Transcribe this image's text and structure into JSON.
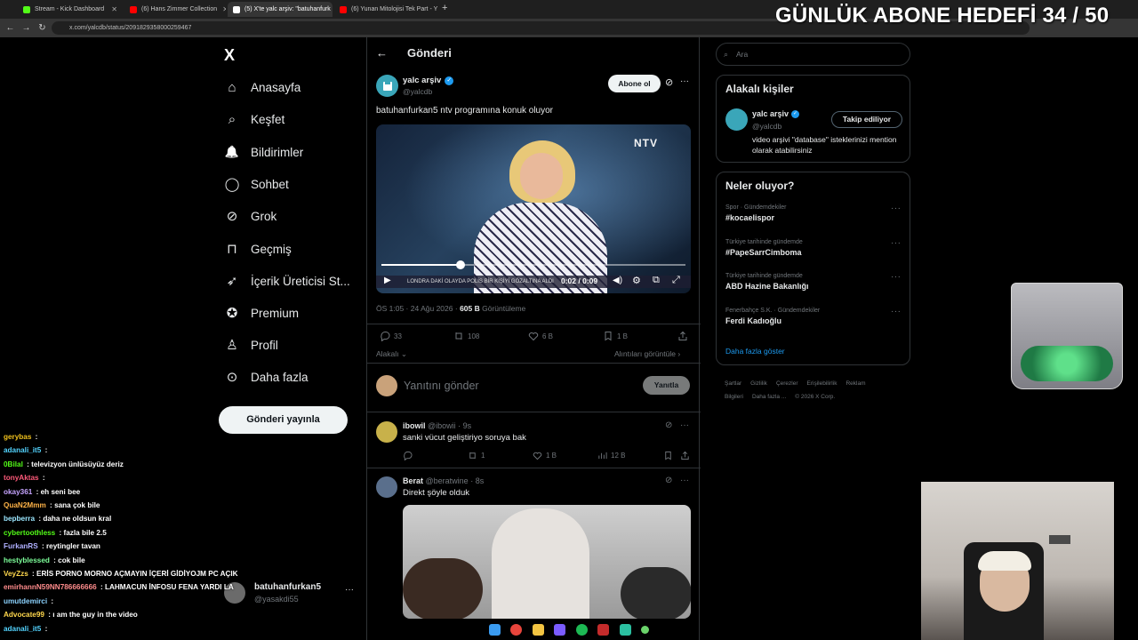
{
  "browser": {
    "tabs": [
      {
        "label": "Stream - Kick Dashboard",
        "fav_color": "#53fc18"
      },
      {
        "label": "(6) Hans Zimmer Collection",
        "fav_color": "#ff0000"
      },
      {
        "label": "(5) X'te yalc arşiv: \"batuhanfurk",
        "fav_color": "#ffffff"
      },
      {
        "label": "(6) Yunan Mitolojisi Tek Part - Y",
        "fav_color": "#ff0000"
      }
    ],
    "url": "x.com/yalcdb/status/2091829358000259467"
  },
  "overlay": {
    "goal_text": "GÜNLÜK ABONE HEDEFİ 34 / 50"
  },
  "nav": {
    "logo": "X",
    "items": [
      {
        "label": "Anasayfa",
        "icon": "home-icon"
      },
      {
        "label": "Keşfet",
        "icon": "search-icon"
      },
      {
        "label": "Bildirimler",
        "icon": "bell-icon"
      },
      {
        "label": "Sohbet",
        "icon": "chat-icon"
      },
      {
        "label": "Grok",
        "icon": "grok-icon"
      },
      {
        "label": "Geçmiş",
        "icon": "bookmark-icon"
      },
      {
        "label": "İçerik Üreticisi St...",
        "icon": "rocket-icon"
      },
      {
        "label": "Premium",
        "icon": "verified-icon"
      },
      {
        "label": "Profil",
        "icon": "person-icon"
      },
      {
        "label": "Daha fazla",
        "icon": "more-circle-icon"
      }
    ],
    "post_button": "Gönderi yayınla",
    "account": {
      "name": "batuhanfurkan5",
      "handle": "@yasakdi55"
    }
  },
  "post": {
    "header_title": "Gönderi",
    "author_name": "yalc arşiv",
    "author_handle": "@yalcdb",
    "subscribe_label": "Abone ol",
    "text": "batuhanfurkan5 ntv programına konuk oluyor",
    "video": {
      "time": "0:02 / 0:09",
      "progress": 0.26,
      "channel_logo": "NTV",
      "ticker": "LONDRA DAKİ OLAYDA POLİS BİR KİŞİYİ GÖZALTINA ALDI"
    },
    "timestamp": "ÖS 1:05 · 24 Ağu 2026 ·",
    "views_count": "605 B",
    "views_label": "Görüntüleme",
    "metrics": {
      "replies": "33",
      "reposts": "108",
      "likes": "6 B",
      "bookmarks": "1 B"
    },
    "relevant_label": "Alakalı",
    "quotes_link": "Alıntıları görüntüle",
    "reply_placeholder": "Yanıtını gönder",
    "reply_button": "Yanıtla"
  },
  "replies": [
    {
      "name": "ibowil",
      "handle": "@ibowii · 9s",
      "text": "sanki vücut geliştiriyo soruya bak",
      "replies": "",
      "reposts": "1",
      "likes": "1 B",
      "views": "12 B"
    },
    {
      "name": "Berat",
      "handle": "@beratwine · 8s",
      "text": "Direkt şöyle olduk"
    }
  ],
  "sidebar": {
    "search_placeholder": "Ara",
    "relevant_title": "Alakalı kişiler",
    "relevant_person": {
      "name": "yalc arşiv",
      "handle": "@yalcdb",
      "follow_label": "Takip ediliyor",
      "bio": "video arşivi \"database\" isteklerinizi mention olarak atabilirsiniz"
    },
    "trends_title": "Neler oluyor?",
    "trends": [
      {
        "meta": "Spor · Gündemdekiler",
        "name": "#kocaelispor"
      },
      {
        "meta": "Türkiye tarihinde gündemde",
        "name": "#PapeSarrCimboma"
      },
      {
        "meta": "Türkiye tarihinde gündemde",
        "name": "ABD Hazine Bakanlığı"
      },
      {
        "meta": "Fenerbahçe S.K. · Gündemdekiler",
        "name": "Ferdi Kadıoğlu"
      }
    ],
    "show_more": "Daha fazla göster",
    "footer": [
      "Şartlar",
      "Gizlilik",
      "Çerezler",
      "Erişilebilirlik",
      "Reklam Bilgileri",
      "Daha fazla ...",
      "© 2026 X Corp."
    ]
  },
  "chat": [
    {
      "user": "gerybas",
      "color": "#f0c11d",
      "msg": ""
    },
    {
      "user": "adanali_it5",
      "color": "#53d4ff",
      "msg": ""
    },
    {
      "user": "0Bilal",
      "color": "#53fc18",
      "msg": "televizyon ünlüsüyüz deriz"
    },
    {
      "user": "tonyAktas",
      "color": "#ff5a7a",
      "msg": ""
    },
    {
      "user": "okay361",
      "color": "#c6a4ff",
      "msg": "eh seni bee"
    },
    {
      "user": "QuaN2Mmm",
      "color": "#ffb347",
      "msg": "sana çok bile"
    },
    {
      "user": "bepberra",
      "color": "#9be7ff",
      "msg": "daha ne oldsun kral"
    },
    {
      "user": "cybertoothless",
      "color": "#53fc18",
      "msg": "fazla bile 2.5"
    },
    {
      "user": "FurkanRS",
      "color": "#b0b0ff",
      "msg": "reytingler tavan"
    },
    {
      "user": "hestyblessed",
      "color": "#7dff9a",
      "msg": "cok bile"
    },
    {
      "user": "VeyZzs",
      "color": "#ffd84d",
      "msg": "ERİS PORNO MORNO AÇMAYIN İÇERİ GİDİYOJM PC AÇIK"
    },
    {
      "user": "emirhannN59NN786666666",
      "color": "#ff8c8c",
      "msg": "LAHMACUN İNFOSU FENA YARDI LA"
    },
    {
      "user": "umutdemirci",
      "color": "#8cd3ff",
      "msg": ""
    },
    {
      "user": "Advocate99",
      "color": "#ffd84d",
      "msg": "ı am the guy in the video"
    },
    {
      "user": "adanali_it5",
      "color": "#53d4ff",
      "msg": ""
    }
  ]
}
